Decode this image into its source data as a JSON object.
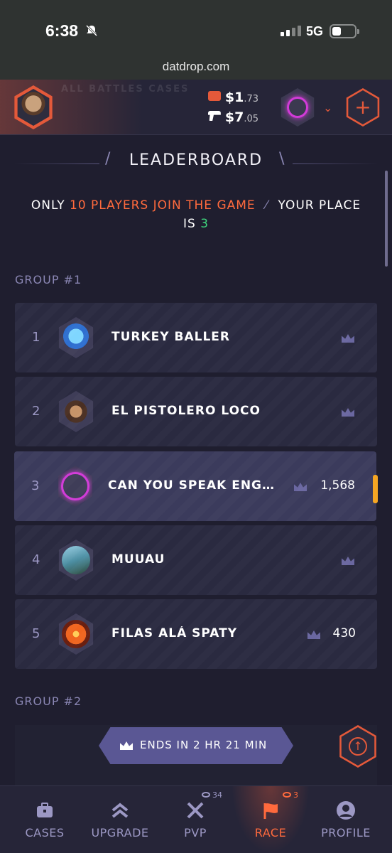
{
  "status_bar": {
    "time": "6:38",
    "network": "5G"
  },
  "browser": {
    "url": "datdrop.com"
  },
  "header": {
    "ghost_text": "ALL BATTLES CASES",
    "balance": {
      "main": "$1",
      "cents": ".73"
    },
    "secondary": {
      "main": "$7",
      "cents": ".05"
    }
  },
  "leaderboard": {
    "title": "LEADERBOARD",
    "subtitle_pre": "ONLY ",
    "subtitle_highlight": "10 PLAYERS JOIN THE GAME",
    "subtitle_sep": "⁄",
    "subtitle_place_label": "YOUR PLACE",
    "subtitle_is": "IS ",
    "subtitle_place_value": "3",
    "groups": [
      {
        "label": "GROUP #1"
      },
      {
        "label": "GROUP #2"
      }
    ],
    "rows": [
      {
        "rank": "1",
        "name": "TURKEY BALLER",
        "score": ""
      },
      {
        "rank": "2",
        "name": "EL PISTOLERO LOCO",
        "score": ""
      },
      {
        "rank": "3",
        "name": "CAN YOU SPEAK ENGLI...",
        "score": "1,568"
      },
      {
        "rank": "4",
        "name": "MUUAU",
        "score": ""
      },
      {
        "rank": "5",
        "name": "FILAS ALÁ SPATY",
        "score": "430"
      }
    ],
    "ends": "ENDS IN 2 HR 21 MIN"
  },
  "nav": {
    "items": [
      {
        "label": "CASES",
        "icon": "briefcase-icon"
      },
      {
        "label": "UPGRADE",
        "icon": "chevrons-up-icon"
      },
      {
        "label": "PVP",
        "icon": "swords-icon",
        "badge": "34"
      },
      {
        "label": "RACE",
        "icon": "flag-icon",
        "badge": "3"
      },
      {
        "label": "PROFILE",
        "icon": "user-icon"
      }
    ]
  },
  "colors": {
    "accent": "#ff6a3d",
    "place": "#3ed67c",
    "bg": "#1f1e2f",
    "highlight_tab": "#f5a623"
  }
}
